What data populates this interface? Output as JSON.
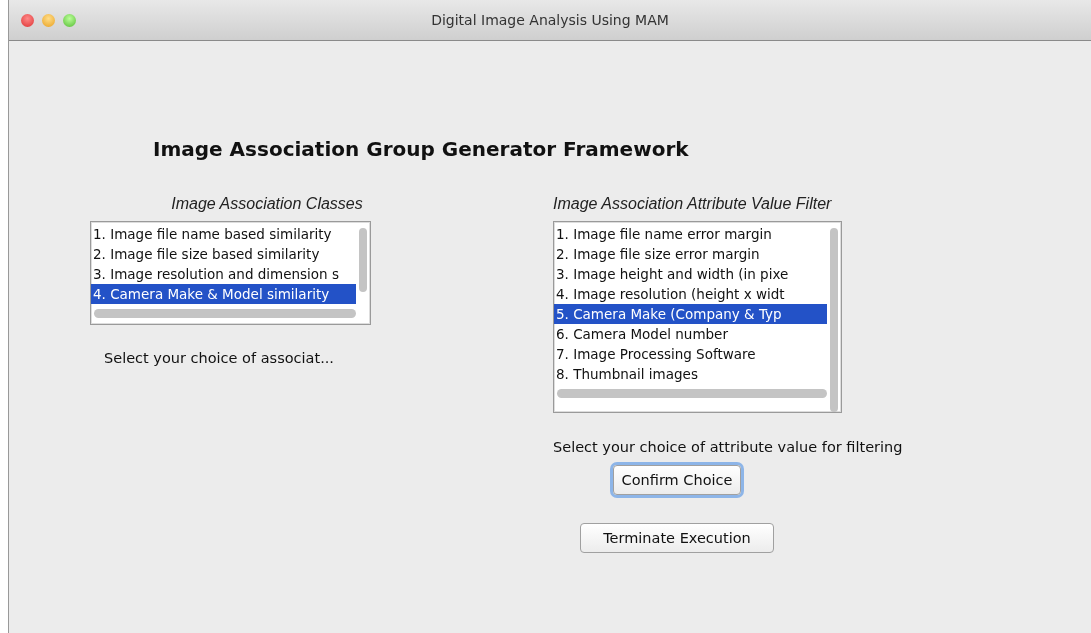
{
  "window": {
    "title": "Digital Image Analysis Using MAM"
  },
  "heading": "Image Association Group Generator Framework",
  "classes": {
    "label": "Image Association Classes",
    "items": [
      {
        "text": "1. Image file name based similarity",
        "selected": false
      },
      {
        "text": "2. Image file size based similarity",
        "selected": false
      },
      {
        "text": "3. Image resolution and dimension s",
        "selected": false
      },
      {
        "text": "4. Camera Make & Model similarity",
        "selected": true
      }
    ],
    "caption": "Select your choice of associat..."
  },
  "filter": {
    "label": "Image Association Attribute Value Filter",
    "items": [
      {
        "text": "1. Image file name error margin",
        "selected": false
      },
      {
        "text": "2. Image file size error margin",
        "selected": false
      },
      {
        "text": "3. Image height and width (in pixe",
        "selected": false
      },
      {
        "text": "4. Image resolution (height x widt",
        "selected": false
      },
      {
        "text": "5. Camera Make (Company & Typ",
        "selected": true
      },
      {
        "text": "6. Camera Model number",
        "selected": false
      },
      {
        "text": "7. Image Processing Software",
        "selected": false
      },
      {
        "text": "8. Thumbnail images",
        "selected": false
      }
    ],
    "caption": "Select your choice of attribute value for filtering"
  },
  "buttons": [
    {
      "label": "Confirm Choice",
      "focused": true
    },
    {
      "label": "Terminate Execution",
      "focused": false
    }
  ]
}
